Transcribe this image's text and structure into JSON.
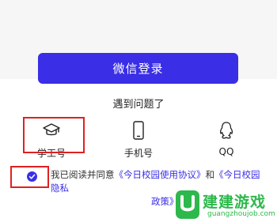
{
  "login": {
    "wechat_button": "微信登录",
    "problem_text": "遇到问题了"
  },
  "options": [
    {
      "label": "学工号",
      "icon": "graduation-cap-icon"
    },
    {
      "label": "手机号",
      "icon": "mobile-phone-icon"
    },
    {
      "label": "QQ",
      "icon": "qq-penguin-icon"
    }
  ],
  "agreement": {
    "prefix": "我已阅读并同意",
    "link1": "《今日校园使用协议》",
    "middle": "和",
    "link2_part1": "《今日校园隐私",
    "link2_part2": "政策》",
    "checked": true
  },
  "watermark": {
    "title": "建建游戏",
    "url": "guangzhoujob.com"
  },
  "colors": {
    "accent": "#3a2ee6",
    "highlight": "#e02020",
    "watermark": "#2db84b"
  }
}
